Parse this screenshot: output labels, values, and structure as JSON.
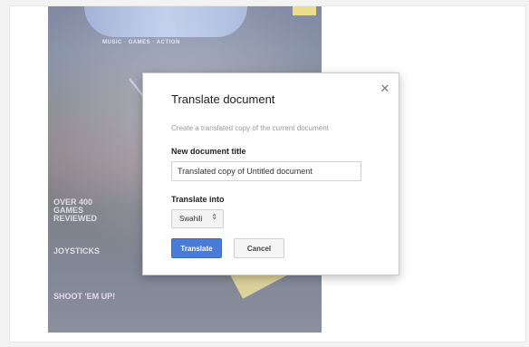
{
  "dialog": {
    "title": "Translate document",
    "close_icon": "close-icon",
    "description": "Create a translated copy of the current document",
    "new_title_label": "New document title",
    "new_title_value": "Translated copy of Untitled document",
    "translate_into_label": "Translate into",
    "language_selected": "Swahili",
    "language_arrow": "▲▼",
    "translate_button": "Translate",
    "cancel_button": "Cancel"
  },
  "cover": {
    "masthead_sub": "MUSIC · GAMES · ACTION",
    "block_1": "OVER 400 GAMES REVIEWED",
    "block_2": "JOYSTICKS",
    "block_3": "SHOOT 'EM UP!"
  },
  "colors": {
    "primary_button": "#4a7bd6",
    "dialog_background": "#ffffff",
    "page_background": "#e9e9e9"
  }
}
